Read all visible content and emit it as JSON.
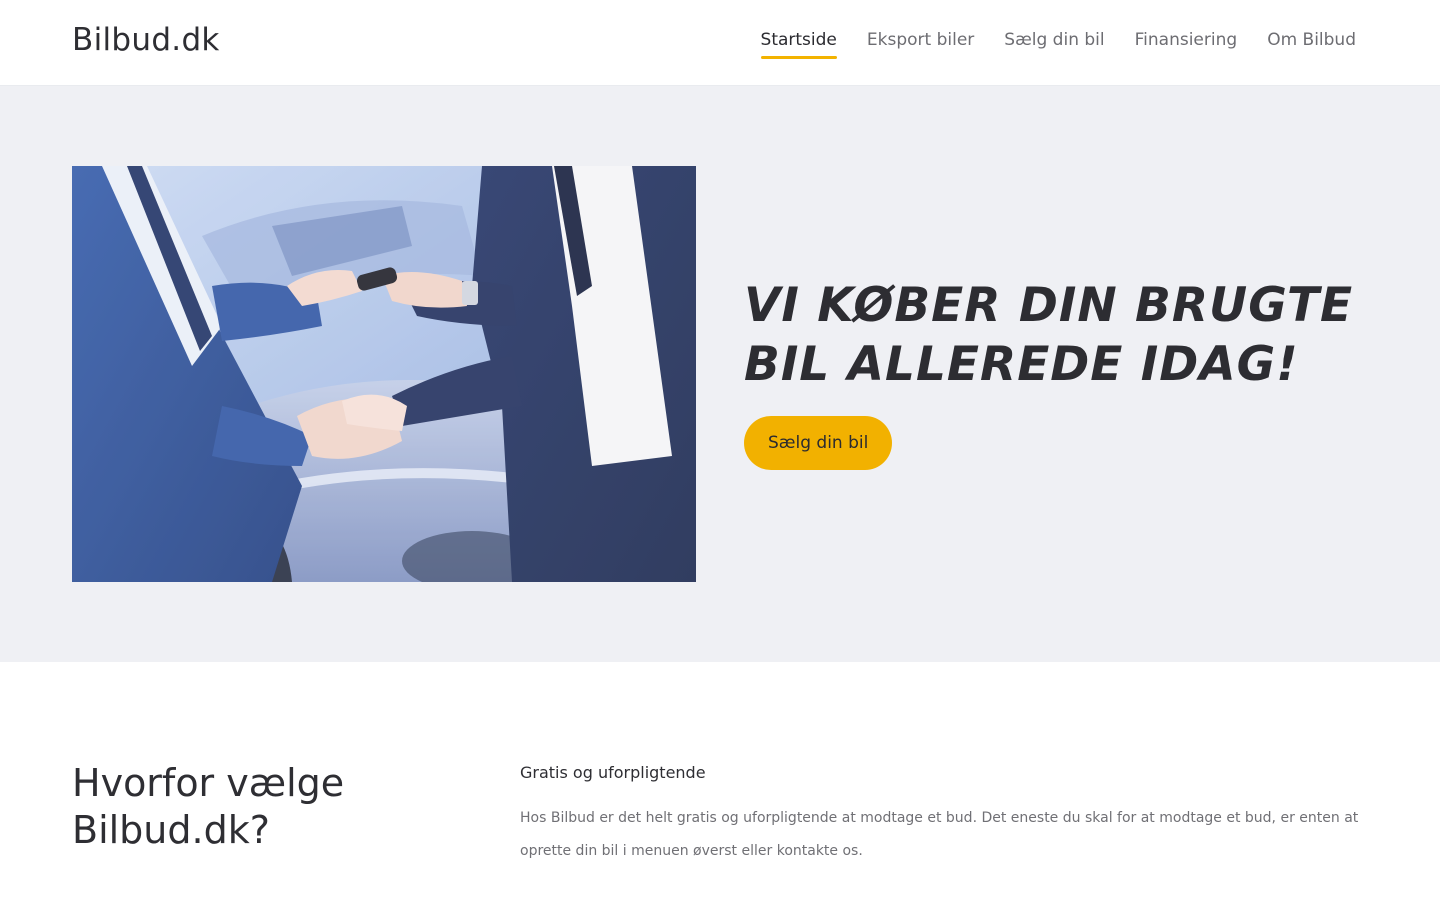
{
  "header": {
    "logo": "Bilbud.dk",
    "nav": [
      {
        "label": "Startside",
        "active": true
      },
      {
        "label": "Eksport biler",
        "active": false
      },
      {
        "label": "Sælg din bil",
        "active": false
      },
      {
        "label": "Finansiering",
        "active": false
      },
      {
        "label": "Om Bilbud",
        "active": false
      }
    ]
  },
  "hero": {
    "title": "VI KØBER DIN BRUGTE BIL ALLEREDE IDAG!",
    "cta_label": "Sælg din bil",
    "image_alt": "Handshake and car key handover in front of a car"
  },
  "why": {
    "title": "Hvorfor vælge Bilbud.dk?",
    "feature_heading": "Gratis og uforpligtende",
    "feature_body": "Hos Bilbud er det helt gratis og uforpligtende at modtage et bud. Det eneste du skal for at modtage et bud, er enten at oprette din bil i menuen øverst eller kontakte os."
  },
  "colors": {
    "accent": "#f2b100",
    "hero_bg": "#eff0f4",
    "text": "#2b2b30"
  }
}
